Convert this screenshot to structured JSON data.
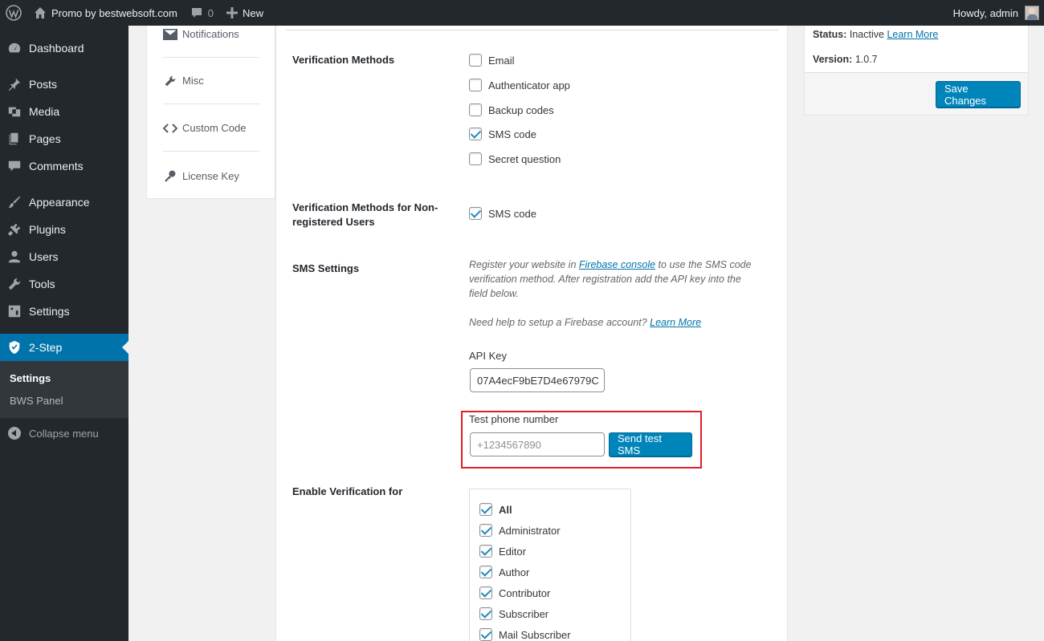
{
  "admin_bar": {
    "site_name": "Promo by bestwebsoft.com",
    "comments_count": "0",
    "new_label": "New",
    "howdy": "Howdy, admin"
  },
  "side_menu": {
    "items": [
      {
        "label": "Dashboard",
        "icon": "dashboard-icon"
      },
      {
        "label": "Posts",
        "icon": "pin-icon"
      },
      {
        "label": "Media",
        "icon": "media-icon"
      },
      {
        "label": "Pages",
        "icon": "pages-icon"
      },
      {
        "label": "Comments",
        "icon": "comments-icon"
      },
      {
        "label": "Appearance",
        "icon": "brush-icon"
      },
      {
        "label": "Plugins",
        "icon": "plugin-icon"
      },
      {
        "label": "Users",
        "icon": "users-icon"
      },
      {
        "label": "Tools",
        "icon": "wrench-icon"
      },
      {
        "label": "Settings",
        "icon": "settings-icon"
      },
      {
        "label": "2-Step",
        "icon": "shield-icon"
      }
    ],
    "submenu": [
      "Settings",
      "BWS Panel"
    ],
    "collapse": "Collapse menu"
  },
  "tabs": [
    {
      "label": "Notifications",
      "icon": "envelope-icon"
    },
    {
      "label": "Misc",
      "icon": "wrench-icon"
    },
    {
      "label": "Custom Code",
      "icon": "code-icon"
    },
    {
      "label": "License Key",
      "icon": "key-icon"
    }
  ],
  "form": {
    "verification_methods": {
      "label": "Verification Methods",
      "options": [
        {
          "label": "Email",
          "checked": false
        },
        {
          "label": "Authenticator app",
          "checked": false
        },
        {
          "label": "Backup codes",
          "checked": false
        },
        {
          "label": "SMS code",
          "checked": true
        },
        {
          "label": "Secret question",
          "checked": false
        }
      ]
    },
    "non_registered": {
      "label_line1": "Verification Methods for Non-",
      "label_line2": "registered Users",
      "option": "SMS code"
    },
    "sms_settings": {
      "label": "SMS Settings",
      "desc_line1_a": "Register your website in ",
      "desc_link": "Firebase console",
      "desc_line1_b": " to use the SMS code",
      "desc_line2": "verification method. After registration add the API key into the",
      "desc_line3": "field below.",
      "help_text": "Need help to setup a Firebase account? ",
      "help_link": "Learn More",
      "api_key_label": "API Key",
      "api_key_value": "07A4ecF9bE7D4e67979C",
      "test_phone_label": "Test phone number",
      "test_phone_placeholder": "+1234567890",
      "send_button": "Send test SMS"
    },
    "enable_for": {
      "label": "Enable Verification for",
      "roles": [
        "All",
        "Administrator",
        "Editor",
        "Author",
        "Contributor",
        "Subscriber",
        "Mail Subscriber"
      ]
    }
  },
  "side_box": {
    "status_label": "Status:",
    "status_value": "Inactive",
    "learn_more": "Learn More",
    "version_label": "Version:",
    "version_value": "1.0.7",
    "save_button": "Save Changes"
  },
  "colors": {
    "accent": "#0073aa",
    "highlight": "#e31e24",
    "admin_bg": "#23282d"
  }
}
